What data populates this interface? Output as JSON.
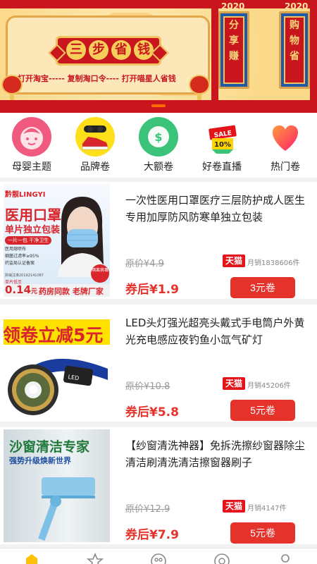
{
  "banner": {
    "title_chars": [
      "三",
      "步",
      "省",
      "钱"
    ],
    "steps": "打开淘宝----- 复制淘口令---- 打开喵星人省钱",
    "year_left": "2020",
    "year_right": "2020",
    "couplet_left": [
      "分",
      "享",
      "赚"
    ],
    "couplet_right": [
      "购",
      "物",
      "省"
    ]
  },
  "categories": [
    {
      "label": "母婴主题",
      "icon": "baby-face-icon"
    },
    {
      "label": "品牌卷",
      "icon": "sneaker-icon"
    },
    {
      "label": "大额卷",
      "icon": "money-bag-icon"
    },
    {
      "label": "好卷直播",
      "icon": "sale-tag-icon"
    },
    {
      "label": "热门卷",
      "icon": "heart-icon"
    }
  ],
  "products": [
    {
      "title": "一次性医用口罩医疗三层防护成人医生专用加厚防风防寒单独立包装",
      "orig": "原价¥4.9",
      "shop": "天猫",
      "sales": "月销1838606件",
      "after": "券后¥1.9",
      "coupon": "3元卷",
      "thumb": {
        "brand": "黔靓LINGYI",
        "headline": "医用口罩",
        "sub": "单片独立包装",
        "pill": "一片一包 干净卫生",
        "bullets": [
          "医用熔喷布",
          "细菌过滤率≥95%",
          "药监局认证备案"
        ],
        "reg": "黔械注准20192141087",
        "price_label": "单片低至",
        "price": "0.14",
        "price_unit": "元",
        "badge": "隔离病毒",
        "footer": "药房同款 老牌厂家"
      }
    },
    {
      "title": "LED头灯强光超亮头戴式手电筒户外黄光充电感应夜钓鱼小氙气矿灯",
      "orig": "原价¥10.8",
      "shop": "天猫",
      "sales": "月销45206件",
      "after": "券后¥5.8",
      "coupon": "5元卷",
      "thumb": {
        "headline": "领卷立减5元",
        "lamp_text": "LED"
      }
    },
    {
      "title": "【纱窗清洗神器】免拆洗擦纱窗器除尘清洁刷清洗清洁擦窗器刷子",
      "orig": "原价¥12.9",
      "shop": "天猫",
      "sales": "月销4147件",
      "after": "券后¥7.9",
      "coupon": "5元卷",
      "thumb": {
        "headline": "沙窗清洁专家",
        "sub": "强势升级焕新世界"
      }
    }
  ],
  "tabbar": [
    "home-icon",
    "star-icon",
    "money-icon",
    "circle-icon",
    "profile-icon"
  ],
  "colors": {
    "accent": "#e5332b",
    "banner_red": "#c9151e",
    "banner_gold": "#f1c35c",
    "pillar_blue": "#1e5aa8"
  }
}
